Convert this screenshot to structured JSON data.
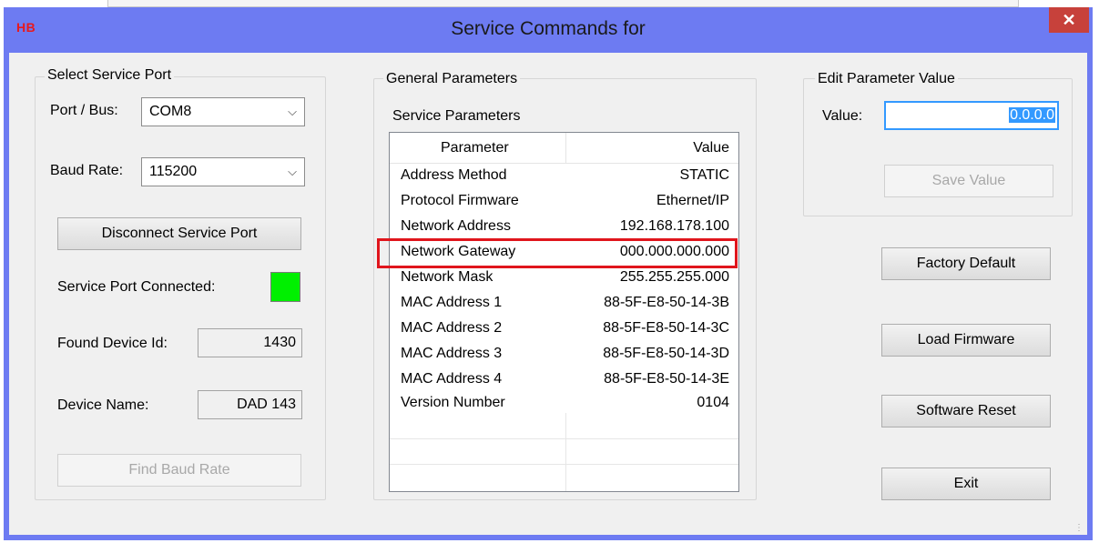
{
  "window": {
    "app_logo": "HB",
    "title": "Service Commands for",
    "close_glyph": "✕"
  },
  "service_port": {
    "legend": "Select Service Port",
    "port_label": "Port / Bus:",
    "port_value": "COM8",
    "baud_label": "Baud Rate:",
    "baud_value": "115200",
    "disconnect_label": "Disconnect Service Port",
    "connected_label": "Service Port Connected:",
    "connected_color": "#00f000",
    "device_id_label": "Found Device Id:",
    "device_id_value": "1430",
    "device_name_label": "Device Name:",
    "device_name_value": "DAD 143",
    "find_baud_label": "Find Baud Rate"
  },
  "general": {
    "legend": "General Parameters",
    "list_title": "Service Parameters",
    "columns": [
      "Parameter",
      "Value"
    ],
    "rows": [
      {
        "parameter": "Address Method",
        "value": "STATIC"
      },
      {
        "parameter": "Protocol Firmware",
        "value": "Ethernet/IP"
      },
      {
        "parameter": "Network Address",
        "value": "192.168.178.100"
      },
      {
        "parameter": "Network Gateway",
        "value": "000.000.000.000"
      },
      {
        "parameter": "Network Mask",
        "value": "255.255.255.000"
      },
      {
        "parameter": "MAC Address 1",
        "value": "88-5F-E8-50-14-3B"
      },
      {
        "parameter": "MAC Address 2",
        "value": "88-5F-E8-50-14-3C"
      },
      {
        "parameter": "MAC Address 3",
        "value": "88-5F-E8-50-14-3D"
      },
      {
        "parameter": "MAC Address 4",
        "value": "88-5F-E8-50-14-3E"
      },
      {
        "parameter": "Version Number",
        "value": "0104"
      }
    ],
    "highlight_color": "#e0151c"
  },
  "edit": {
    "legend": "Edit Parameter Value",
    "value_label": "Value:",
    "value": "0.0.0.0",
    "save_label": "Save Value"
  },
  "actions": {
    "factory_default": "Factory Default",
    "load_firmware": "Load Firmware",
    "software_reset": "Software Reset",
    "exit": "Exit"
  },
  "icons": {
    "dropdown": "chevron-down-icon",
    "close": "close-icon",
    "resize": "resize-grip-icon"
  }
}
